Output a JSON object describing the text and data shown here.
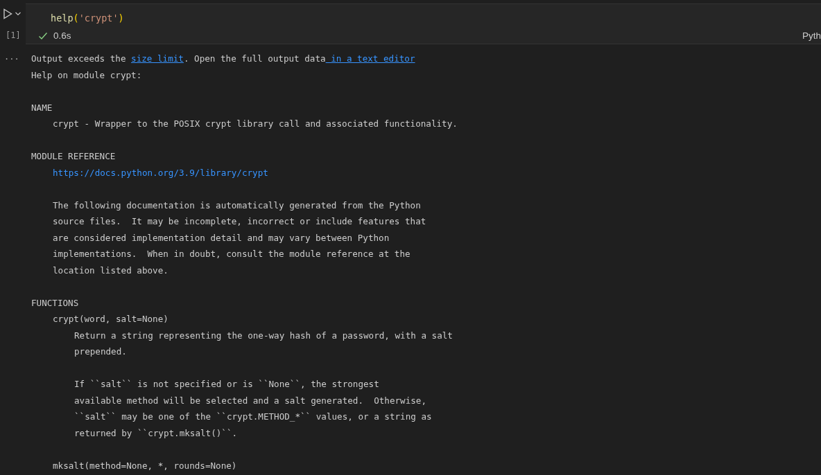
{
  "cell": {
    "code": [
      {
        "kind": "function",
        "text": "help"
      },
      {
        "kind": "paren",
        "text": "("
      },
      {
        "kind": "string",
        "text": "'crypt'"
      },
      {
        "kind": "paren",
        "text": ")"
      }
    ],
    "execution_count": "[1]",
    "succeeded": true,
    "duration": "0.6s",
    "language": "Pyth"
  },
  "output": {
    "menu": "···",
    "notice": [
      {
        "kind": "text",
        "text": "Output exceeds the "
      },
      {
        "kind": "link",
        "text": "size limit"
      },
      {
        "kind": "text",
        "text": ". Open the full output data"
      },
      {
        "kind": "link",
        "text": " in a text editor"
      }
    ],
    "blocks": [
      {
        "kind": "text",
        "lines": [
          "Help on module crypt:"
        ]
      },
      {
        "kind": "text",
        "lines": [
          "NAME"
        ],
        "children": [
          {
            "kind": "text",
            "lines": [
              "crypt - Wrapper to the POSIX crypt library call and associated functionality."
            ]
          }
        ]
      },
      {
        "kind": "text",
        "lines": [
          "MODULE REFERENCE"
        ],
        "children": [
          {
            "kind": "link",
            "lines": [
              "https://docs.python.org/3.9/library/crypt"
            ]
          },
          {
            "kind": "text",
            "lines": [
              "The following documentation is automatically generated from the Python",
              "source files.  It may be incomplete, incorrect or include features that",
              "are considered implementation detail and may vary between Python",
              "implementations.  When in doubt, consult the module reference at the",
              "location listed above."
            ]
          }
        ]
      },
      {
        "kind": "text",
        "lines": [
          "FUNCTIONS"
        ],
        "children": [
          {
            "kind": "text",
            "lines": [
              "crypt(word, salt=None)"
            ],
            "children": [
              {
                "kind": "text",
                "lines": [
                  "Return a string representing the one-way hash of a password, with a salt",
                  "prepended."
                ]
              },
              {
                "kind": "text",
                "lines": [
                  "If ``salt`` is not specified or is ``None``, the strongest",
                  "available method will be selected and a salt generated.  Otherwise,",
                  "``salt`` may be one of the ``crypt.METHOD_*`` values, or a string as",
                  "returned by ``crypt.mksalt()``."
                ]
              }
            ]
          },
          {
            "kind": "text",
            "lines": [
              "mksalt(method=None, *, rounds=None)"
            ]
          }
        ]
      }
    ]
  }
}
